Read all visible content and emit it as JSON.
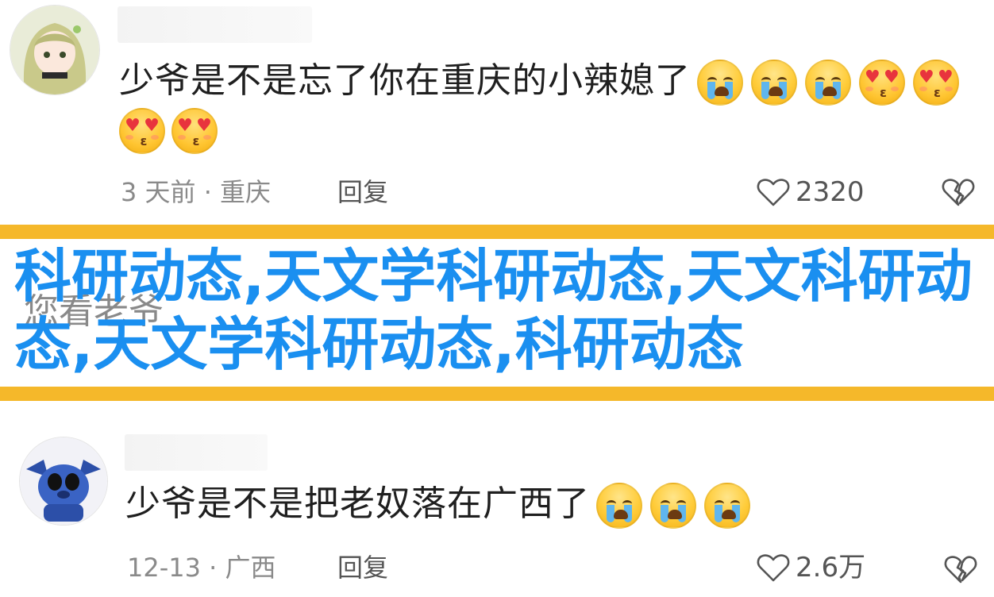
{
  "comments": [
    {
      "text": "少爷是不是忘了你在重庆的小辣媳了",
      "emoji_line1": [
        "loudly-crying-face",
        "loudly-crying-face",
        "loudly-crying-face",
        "smiling-face-with-heart-eyes",
        "smiling-face-with-heart-eyes"
      ],
      "emoji_line2": [
        "smiling-face-with-heart-eyes",
        "smiling-face-with-heart-eyes"
      ],
      "meta": "3 天前 · 重庆",
      "reply_label": "回复",
      "like_count": "2320"
    },
    {
      "text": "少爷是不是把老奴落在广西了",
      "emoji_line1": [
        "loudly-crying-face",
        "loudly-crying-face",
        "loudly-crying-face"
      ],
      "meta": "12-13 · 广西",
      "reply_label": "回复",
      "like_count": "2.6万"
    }
  ],
  "banner": {
    "text": "科研动态,天文学科研动态,天文科研动态,天文学科研动态,科研动态",
    "partially_hidden_comment": "您看老爷",
    "accent_color": "#1a8ff0",
    "bar_color": "#f5b82a"
  }
}
